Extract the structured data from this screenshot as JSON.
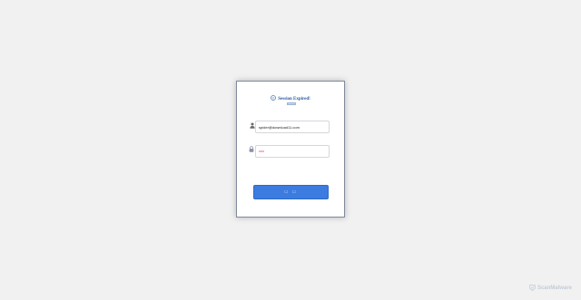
{
  "dialog": {
    "title": "Session Expired!",
    "title_color": "#2b5aa6",
    "email_value": "spider@download11.com",
    "password_placeholder": "",
    "submit_label": "☐ ☐",
    "button_color": "#3c7be0",
    "user_icon": "user-icon",
    "lock_icon": "lock-icon",
    "status_icon": "smiley-icon"
  },
  "watermark": {
    "text": "ScanMalware",
    "icon": "scanmalware-logo-icon"
  }
}
